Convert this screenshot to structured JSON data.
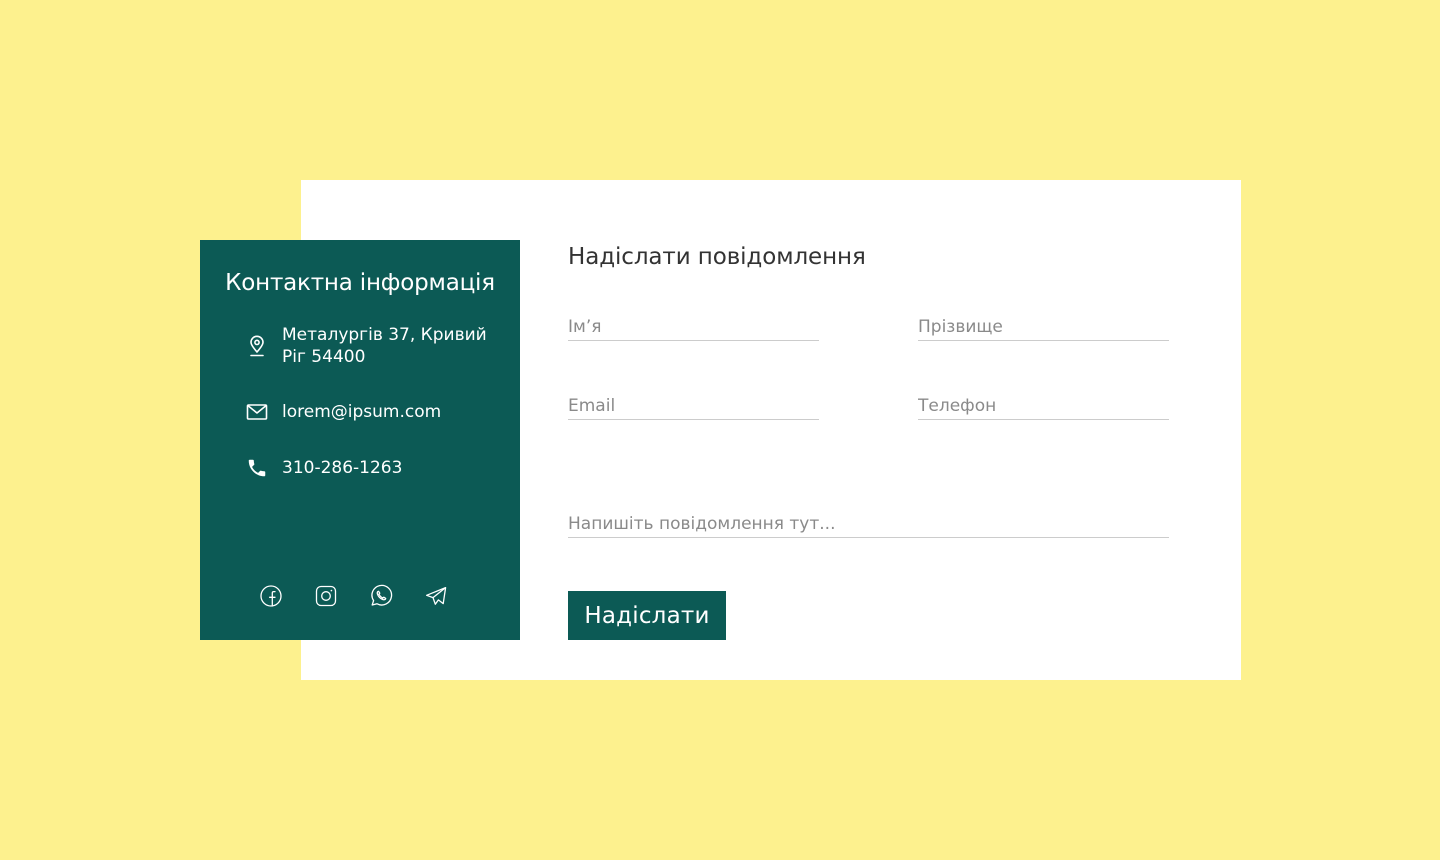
{
  "colors": {
    "background": "#fdf18e",
    "card": "#ffffff",
    "accent": "#0c5a55",
    "text_dark": "#333333",
    "placeholder": "#8a8a8a",
    "field_underline": "#cccccc"
  },
  "contact": {
    "title": "Контактна інформація",
    "address": "Металургів 37, Кривий Ріг 54400",
    "email": "lorem@ipsum.com",
    "phone": "310-286-1263",
    "icons": {
      "address": "map-pin-icon",
      "email": "mail-icon",
      "phone": "phone-icon"
    },
    "socials": [
      {
        "icon": "facebook-icon"
      },
      {
        "icon": "instagram-icon"
      },
      {
        "icon": "whatsapp-icon"
      },
      {
        "icon": "telegram-icon"
      }
    ]
  },
  "form": {
    "title": "Надіслати повідомлення",
    "first_name": {
      "placeholder": "Ім’я",
      "value": ""
    },
    "last_name": {
      "placeholder": "Прізвище",
      "value": ""
    },
    "email": {
      "placeholder": "Email",
      "value": ""
    },
    "phone": {
      "placeholder": "Телефон",
      "value": ""
    },
    "message": {
      "placeholder": "Напишіть повідомлення тут...",
      "value": ""
    },
    "submit_label": "Надіслати"
  }
}
